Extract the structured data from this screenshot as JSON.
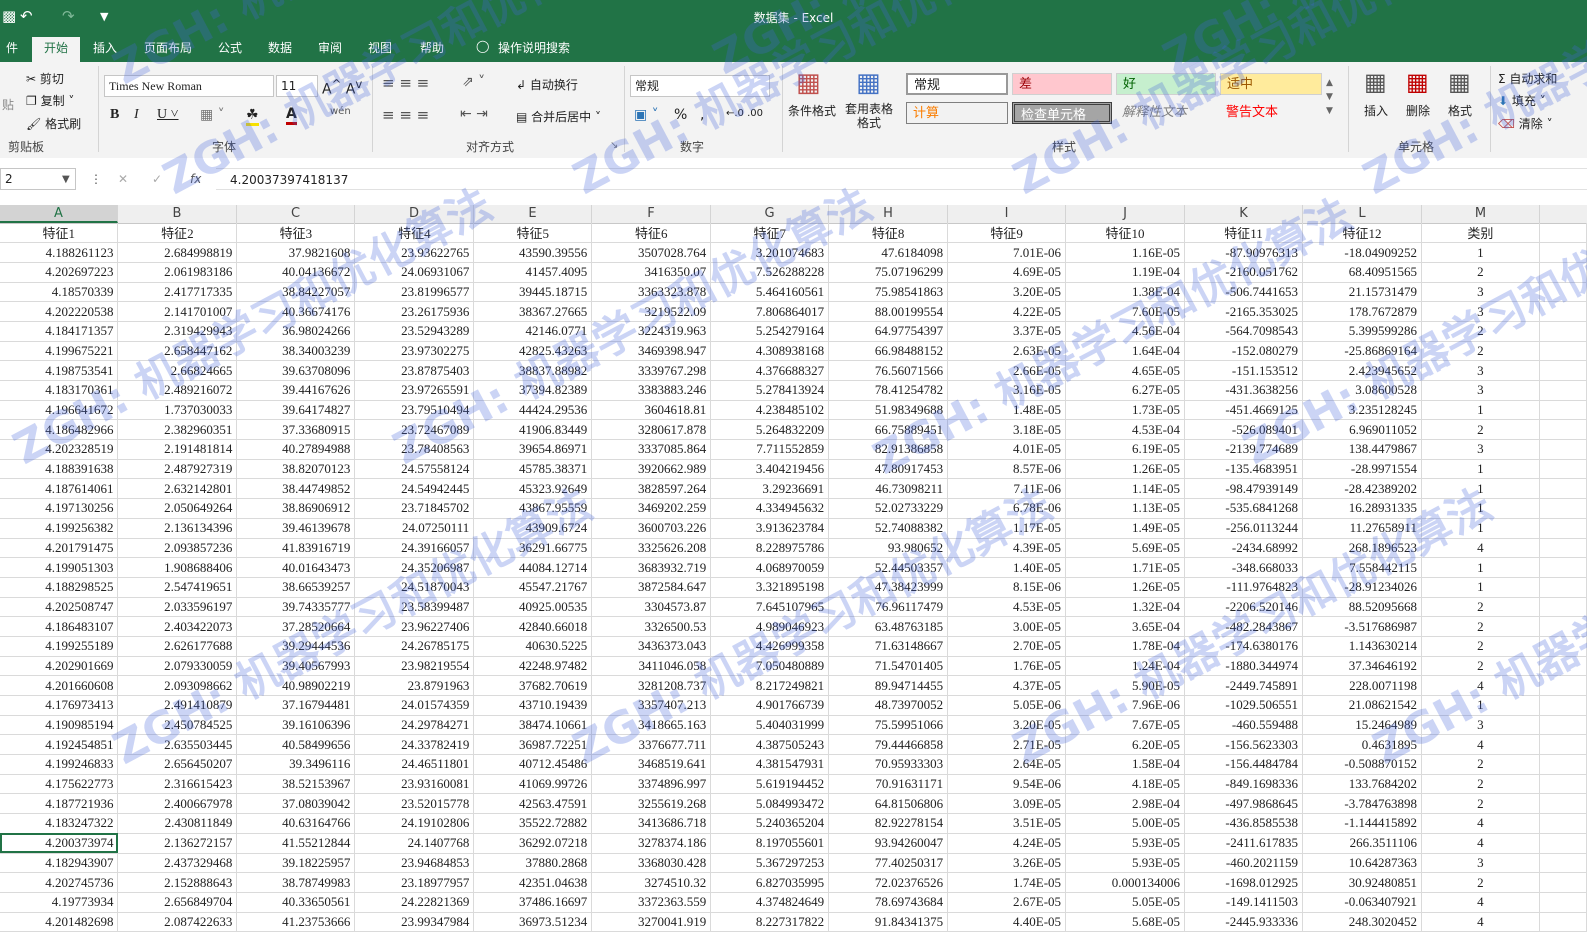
{
  "window": {
    "title": "数据集 - Excel"
  },
  "tabs": [
    "件",
    "开始",
    "插入",
    "页面布局",
    "公式",
    "数据",
    "审阅",
    "视图",
    "帮助"
  ],
  "active_tab": "开始",
  "tell_me": "操作说明搜索",
  "ribbon": {
    "clipboard": {
      "cut": "剪切",
      "copy": "复制",
      "format_painter": "格式刷",
      "paste": "贴",
      "label": "剪贴板"
    },
    "font": {
      "name": "Times New Roman",
      "size": "11",
      "label": "字体"
    },
    "alignment": {
      "wrap": "自动换行",
      "merge": "合并后居中",
      "label": "对齐方式"
    },
    "number": {
      "format": "常规",
      "label": "数字"
    },
    "styles": {
      "conditional": "条件格式",
      "table": "套用表格格式",
      "normal": "常规",
      "bad": "差",
      "good": "好",
      "neutral": "适中",
      "calc": "计算",
      "check": "检查单元格",
      "explain": "解释性文本",
      "warning": "警告文本",
      "label": "样式"
    },
    "cells": {
      "insert": "插入",
      "delete": "删除",
      "format": "格式",
      "label": "单元格"
    },
    "editing": {
      "autosum": "自动求和",
      "fill": "填充",
      "clear": "清除"
    }
  },
  "formula_bar": {
    "name_box": "2",
    "fx": "fx",
    "value": "4.20037397418137"
  },
  "columns": [
    "A",
    "B",
    "C",
    "D",
    "E",
    "F",
    "G",
    "H",
    "I",
    "J",
    "K",
    "L",
    "M"
  ],
  "header_row": [
    "特征1",
    "特征2",
    "特征3",
    "特征4",
    "特征5",
    "特征6",
    "特征7",
    "特征8",
    "特征9",
    "特征10",
    "特征11",
    "特征12",
    "类别"
  ],
  "rows": [
    [
      "4.188261123",
      "2.684998819",
      "37.9821608",
      "23.93622765",
      "43590.39556",
      "3507028.764",
      "3.201074683",
      "47.6184098",
      "7.01E-06",
      "1.16E-05",
      "-87.90976313",
      "-18.04909252",
      "1"
    ],
    [
      "4.202697223",
      "2.061983186",
      "40.04136672",
      "24.06931067",
      "41457.4095",
      "3416350.07",
      "7.526288228",
      "75.07196299",
      "4.69E-05",
      "1.19E-04",
      "-2160.051762",
      "68.40951565",
      "2"
    ],
    [
      "4.18570339",
      "2.417717335",
      "38.84227057",
      "23.81996577",
      "39445.18715",
      "3363323.878",
      "5.464160561",
      "75.98541863",
      "3.20E-05",
      "1.38E-04",
      "-506.7441653",
      "21.15731479",
      "3"
    ],
    [
      "4.202220538",
      "2.141701007",
      "40.36674176",
      "23.26175936",
      "38367.27665",
      "3219522.09",
      "7.806864017",
      "88.00199554",
      "4.22E-05",
      "7.60E-05",
      "-2165.353025",
      "178.7672879",
      "3"
    ],
    [
      "4.184171357",
      "2.319429943",
      "36.98024266",
      "23.52943289",
      "42146.0771",
      "3224319.963",
      "5.254279164",
      "64.97754397",
      "3.37E-05",
      "4.56E-04",
      "-564.7098543",
      "5.399599286",
      "2"
    ],
    [
      "4.199675221",
      "2.658447162",
      "38.34003239",
      "23.97302275",
      "42825.43263",
      "3469398.947",
      "4.308938168",
      "66.98488152",
      "2.63E-05",
      "1.64E-04",
      "-152.080279",
      "-25.86869164",
      "2"
    ],
    [
      "4.198753541",
      "2.66824665",
      "39.63708096",
      "23.87875403",
      "38837.88982",
      "3339767.298",
      "4.376688327",
      "76.56071566",
      "2.66E-05",
      "4.65E-05",
      "-151.153512",
      "2.423945652",
      "3"
    ],
    [
      "4.183170361",
      "2.489216072",
      "39.44167626",
      "23.97265591",
      "37394.82389",
      "3383883.246",
      "5.278413924",
      "78.41254782",
      "3.16E-05",
      "6.27E-05",
      "-431.3638256",
      "3.08600528",
      "3"
    ],
    [
      "4.196641672",
      "1.737030033",
      "39.64174827",
      "23.79510494",
      "44424.29536",
      "3604618.81",
      "4.238485102",
      "51.98349688",
      "1.48E-05",
      "1.73E-05",
      "-451.4669125",
      "3.235128245",
      "1"
    ],
    [
      "4.186482966",
      "2.382960351",
      "37.33680915",
      "23.72467089",
      "41906.83449",
      "3280617.878",
      "5.264832209",
      "66.75889451",
      "3.18E-05",
      "4.53E-04",
      "-526.089401",
      "6.969011052",
      "2"
    ],
    [
      "4.202328519",
      "2.191481814",
      "40.27894988",
      "23.78408563",
      "39654.86971",
      "3337085.864",
      "7.711552859",
      "82.91386858",
      "4.01E-05",
      "6.19E-05",
      "-2139.774689",
      "138.4479867",
      "3"
    ],
    [
      "4.188391638",
      "2.487927319",
      "38.82070123",
      "24.57558124",
      "45785.38371",
      "3920662.989",
      "3.404219456",
      "47.80917453",
      "8.57E-06",
      "1.26E-05",
      "-135.4683951",
      "-28.9971554",
      "1"
    ],
    [
      "4.187614061",
      "2.632142801",
      "38.44749852",
      "24.54942445",
      "45323.92649",
      "3828597.264",
      "3.29236691",
      "46.73098211",
      "7.11E-06",
      "1.14E-05",
      "-98.47939149",
      "-28.42389202",
      "1"
    ],
    [
      "4.197130256",
      "2.050649264",
      "38.86906912",
      "23.71845702",
      "43867.95559",
      "3469202.259",
      "4.334945632",
      "52.02733229",
      "6.78E-06",
      "1.13E-05",
      "-535.6841268",
      "16.28931335",
      "1"
    ],
    [
      "4.199256382",
      "2.136134396",
      "39.46139678",
      "24.07250111",
      "43909.6724",
      "3600703.226",
      "3.913623784",
      "52.74088382",
      "1.17E-05",
      "1.49E-05",
      "-256.0113244",
      "11.27658911",
      "1"
    ],
    [
      "4.201791475",
      "2.093857236",
      "41.83916719",
      "24.39166057",
      "36291.66775",
      "3325626.208",
      "8.228975786",
      "93.980652",
      "4.39E-05",
      "5.69E-05",
      "-2434.68992",
      "268.1896523",
      "4"
    ],
    [
      "4.199051303",
      "1.908688406",
      "40.01643473",
      "24.35206987",
      "44084.12714",
      "3683932.719",
      "4.068970059",
      "52.44503357",
      "1.40E-05",
      "1.71E-05",
      "-348.668033",
      "7.558442115",
      "1"
    ],
    [
      "4.188298525",
      "2.547419651",
      "38.66539257",
      "24.51870043",
      "45547.21767",
      "3872584.647",
      "3.321895198",
      "47.38423999",
      "8.15E-06",
      "1.26E-05",
      "-111.9764823",
      "-28.91234026",
      "1"
    ],
    [
      "4.202508747",
      "2.033596197",
      "39.74335777",
      "23.58399487",
      "40925.00535",
      "3304573.87",
      "7.645107965",
      "76.96117479",
      "4.53E-05",
      "1.32E-04",
      "-2206.520146",
      "88.52095668",
      "2"
    ],
    [
      "4.186483107",
      "2.403422073",
      "37.28520664",
      "23.96227406",
      "42840.66018",
      "3326500.53",
      "4.989046923",
      "63.48763185",
      "3.00E-05",
      "3.65E-04",
      "-482.2843867",
      "-3.517686987",
      "2"
    ],
    [
      "4.199255189",
      "2.626177688",
      "39.29444536",
      "24.26785175",
      "40630.5225",
      "3436373.043",
      "4.426999358",
      "71.63148667",
      "2.70E-05",
      "1.78E-04",
      "-174.6380176",
      "1.143630214",
      "2"
    ],
    [
      "4.202901669",
      "2.079330059",
      "39.40567993",
      "23.98219554",
      "42248.97482",
      "3411046.058",
      "7.050480889",
      "71.54701405",
      "1.76E-05",
      "1.24E-04",
      "-1880.344974",
      "37.34646192",
      "2"
    ],
    [
      "4.201660608",
      "2.093098662",
      "40.98902219",
      "23.8791963",
      "37682.70619",
      "3281208.737",
      "8.217249821",
      "89.94714455",
      "4.37E-05",
      "5.90E-05",
      "-2449.745891",
      "228.0071198",
      "4"
    ],
    [
      "4.176973413",
      "2.491410879",
      "37.16794481",
      "24.01574359",
      "43710.19439",
      "3357407.213",
      "4.901766739",
      "48.73970052",
      "5.05E-06",
      "7.96E-06",
      "-1029.506551",
      "21.08621542",
      "1"
    ],
    [
      "4.190985194",
      "2.450784525",
      "39.16106396",
      "24.29784271",
      "38474.10661",
      "3418665.163",
      "5.404031999",
      "75.59951066",
      "3.20E-05",
      "7.67E-05",
      "-460.559488",
      "15.2464989",
      "3"
    ],
    [
      "4.192454851",
      "2.635503445",
      "40.58499656",
      "24.33782419",
      "36987.72251",
      "3376677.711",
      "4.387505243",
      "79.44466858",
      "2.71E-05",
      "6.20E-05",
      "-156.5623303",
      "0.4631895",
      "4"
    ],
    [
      "4.199246833",
      "2.656450207",
      "39.3496116",
      "24.46511801",
      "40712.45486",
      "3468519.641",
      "4.381547931",
      "70.95933303",
      "2.64E-05",
      "1.58E-04",
      "-156.4484784",
      "-0.508870152",
      "2"
    ],
    [
      "4.175622773",
      "2.316615423",
      "38.52153967",
      "23.93160081",
      "41069.99726",
      "3374896.997",
      "5.619194452",
      "70.91631171",
      "9.54E-06",
      "4.18E-05",
      "-849.1698336",
      "133.7684202",
      "2"
    ],
    [
      "4.187721936",
      "2.400667978",
      "37.08039042",
      "23.52015778",
      "42563.47591",
      "3255619.268",
      "5.084993472",
      "64.81506806",
      "3.09E-05",
      "2.98E-04",
      "-497.9868645",
      "-3.784763898",
      "2"
    ],
    [
      "4.183247322",
      "2.430811849",
      "40.63164766",
      "24.19102806",
      "35522.72882",
      "3413686.718",
      "5.240365204",
      "82.92278154",
      "3.51E-05",
      "5.00E-05",
      "-436.8585538",
      "-1.144415892",
      "4"
    ],
    [
      "4.200373974",
      "2.136272157",
      "41.55212844",
      "24.1407768",
      "36292.07218",
      "3278374.186",
      "8.197055601",
      "93.94260047",
      "4.24E-05",
      "5.93E-05",
      "-2411.617835",
      "266.3511106",
      "4"
    ],
    [
      "4.182943907",
      "2.437329468",
      "39.18225957",
      "23.94684853",
      "37880.2868",
      "3368030.428",
      "5.367297253",
      "77.40250317",
      "3.26E-05",
      "5.93E-05",
      "-460.2021159",
      "10.64287363",
      "3"
    ],
    [
      "4.202745736",
      "2.152888643",
      "38.78749983",
      "23.18977957",
      "42351.04638",
      "3274510.32",
      "6.827035995",
      "72.02376526",
      "1.74E-05",
      "0.000134006",
      "-1698.012925",
      "30.92480851",
      "2"
    ],
    [
      "4.19773934",
      "2.656849704",
      "40.33650561",
      "24.22821369",
      "37486.16697",
      "3372363.559",
      "4.374824649",
      "78.69743684",
      "2.67E-05",
      "5.05E-05",
      "-149.1411503",
      "-0.063407921",
      "4"
    ],
    [
      "4.201482698",
      "2.087422633",
      "41.23753666",
      "23.99347984",
      "36973.51234",
      "3270041.919",
      "8.227317822",
      "91.84341375",
      "4.40E-05",
      "5.68E-05",
      "-2445.933336",
      "248.3020452",
      "4"
    ]
  ],
  "watermark": "ZGH: 机器学习和优化算法"
}
